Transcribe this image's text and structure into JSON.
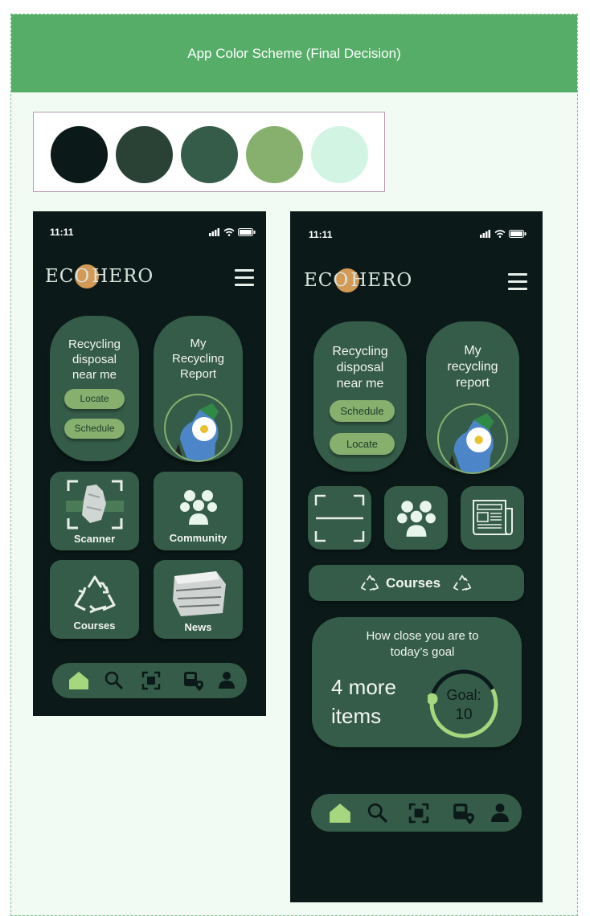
{
  "board": {
    "title": "App Color Scheme (Final Decision)"
  },
  "palette": [
    "#0b1a19",
    "#2a4236",
    "#355c48",
    "#87b06f",
    "#d2f4e3"
  ],
  "phone1": {
    "time": "11:11",
    "logo_left": "ECO",
    "logo_right": "HERO",
    "card_disposal": "Recycling disposal near me",
    "card_report": "My Recycling Report",
    "locate": "Locate",
    "schedule": "Schedule",
    "scanner": "Scanner",
    "community": "Community",
    "courses": "Courses",
    "news": "News"
  },
  "phone2": {
    "time": "11:11",
    "logo_left": "ECO",
    "logo_right": "HERO",
    "card_disposal": "Recycling disposal near me",
    "card_report": "My recycling report",
    "schedule": "Schedule",
    "locate": "Locate",
    "courses": "Courses",
    "goal_heading": "How close you are to today’s goal",
    "goal_remaining_1": "4 more",
    "goal_remaining_2": "items",
    "goal_label": "Goal:",
    "goal_value": "10",
    "goal_progress": 0.6
  },
  "nav_icons": [
    "home-icon",
    "search-icon",
    "scan-icon",
    "bus-location-icon",
    "profile-icon"
  ],
  "colors": {
    "nav_active": "#a6d77e",
    "nav_inactive": "#0b1a19"
  }
}
